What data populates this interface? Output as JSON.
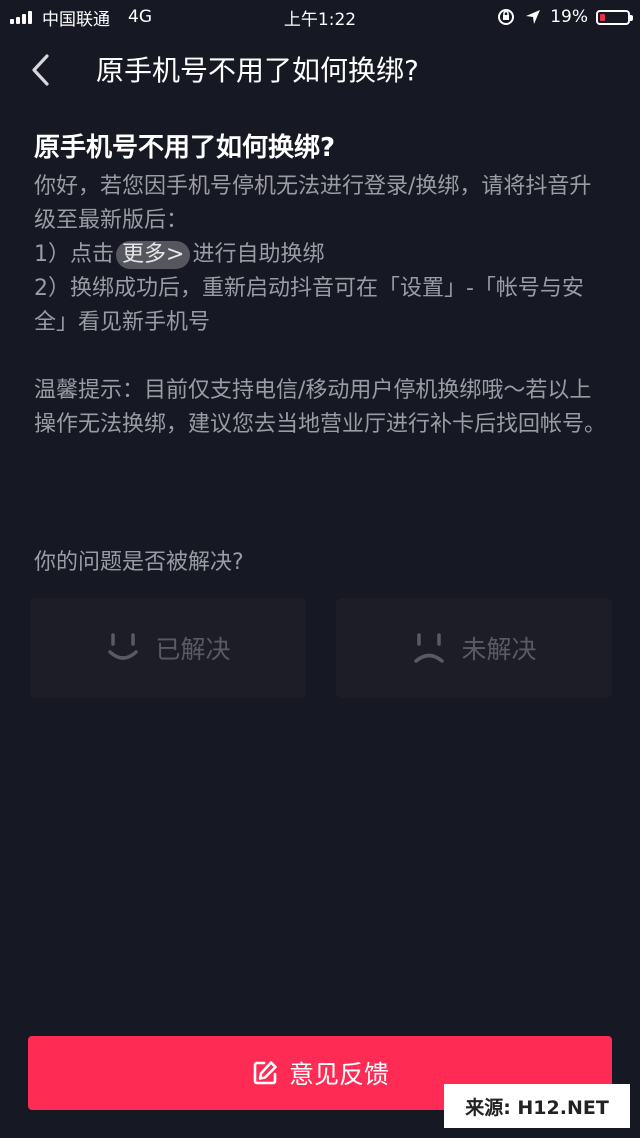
{
  "status_bar": {
    "carrier": "中国联通",
    "network": "4G",
    "time": "上午1:22",
    "battery": "19%",
    "battery_level": 0.19,
    "battery_color": "#e8304a"
  },
  "nav": {
    "back_icon": "chevron-left-icon",
    "title": "原手机号不用了如何换绑?"
  },
  "article": {
    "title": "原手机号不用了如何换绑?",
    "intro": "你好，若您因手机号停机无法进行登录/换绑，请将抖音升级至最新版后：",
    "step1_prefix": "1）点击",
    "step1_link": "更多>",
    "step1_suffix": "进行自助换绑",
    "step2": "2）换绑成功后，重新启动抖音可在「设置」-「帐号与安全」看见新手机号",
    "tip": "温馨提示：目前仅支持电信/移动用户停机换绑哦～若以上操作无法换绑，建议您去当地营业厅进行补卡后找回帐号。"
  },
  "feedback": {
    "question": "你的问题是否被解决?",
    "resolved_label": "已解决",
    "resolved_icon": "smile-icon",
    "unresolved_label": "未解决",
    "unresolved_icon": "frown-icon"
  },
  "bottom_button": {
    "label": "意见反馈",
    "icon": "edit-icon",
    "color": "#fe2c55"
  },
  "watermark": {
    "text": "来源: H12.NET"
  }
}
